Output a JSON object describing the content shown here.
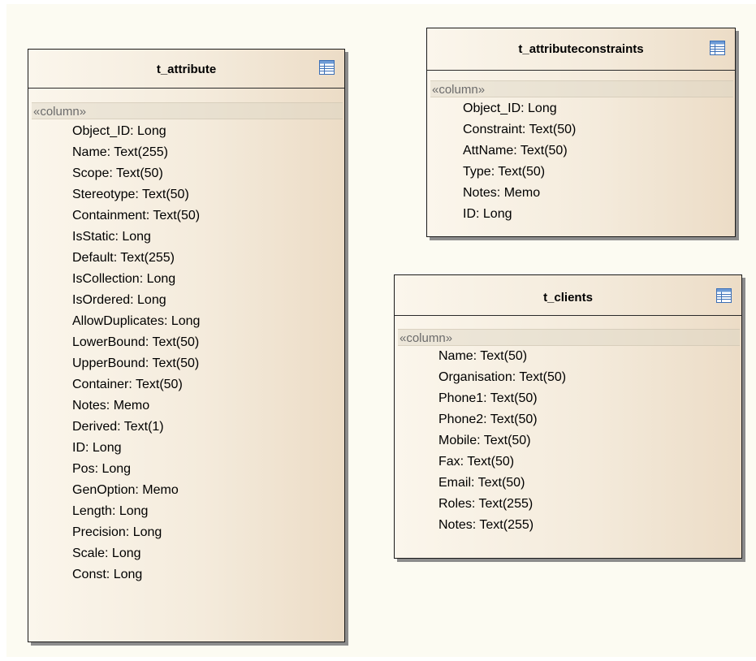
{
  "tables": [
    {
      "title": "t_attribute",
      "icon": "table-icon",
      "stereotype": "«column»",
      "columns": [
        "Object_ID:  Long",
        "Name:  Text(255)",
        "Scope:  Text(50)",
        "Stereotype:  Text(50)",
        "Containment:  Text(50)",
        "IsStatic:  Long",
        "Default:  Text(255)",
        "IsCollection:  Long",
        "IsOrdered:  Long",
        "AllowDuplicates:  Long",
        "LowerBound:  Text(50)",
        "UpperBound:  Text(50)",
        "Container:  Text(50)",
        "Notes:  Memo",
        "Derived:  Text(1)",
        "ID:  Long",
        "Pos:  Long",
        "GenOption:  Memo",
        "Length:  Long",
        "Precision:  Long",
        "Scale:  Long",
        "Const:  Long"
      ]
    },
    {
      "title": "t_attributeconstraints",
      "icon": "table-icon",
      "stereotype": "«column»",
      "columns": [
        "Object_ID:  Long",
        "Constraint:  Text(50)",
        "AttName:  Text(50)",
        "Type:  Text(50)",
        "Notes:  Memo",
        "ID:  Long"
      ]
    },
    {
      "title": "t_clients",
      "icon": "table-icon",
      "stereotype": "«column»",
      "columns": [
        "Name:  Text(50)",
        "Organisation:  Text(50)",
        "Phone1:  Text(50)",
        "Phone2:  Text(50)",
        "Mobile:  Text(50)",
        "Fax:  Text(50)",
        "Email:  Text(50)",
        "Roles:  Text(255)",
        "Notes:  Text(255)"
      ]
    }
  ],
  "colors": {
    "canvas": "#fcfbf2",
    "element_fill_light": "#fbf6ec",
    "element_fill_dark": "#ecdcc6",
    "border": "#1a1a1a",
    "shadow": "#8c8c8c",
    "stereotype_text": "#6b6b6b",
    "icon_blue": "#3b6fb6"
  }
}
